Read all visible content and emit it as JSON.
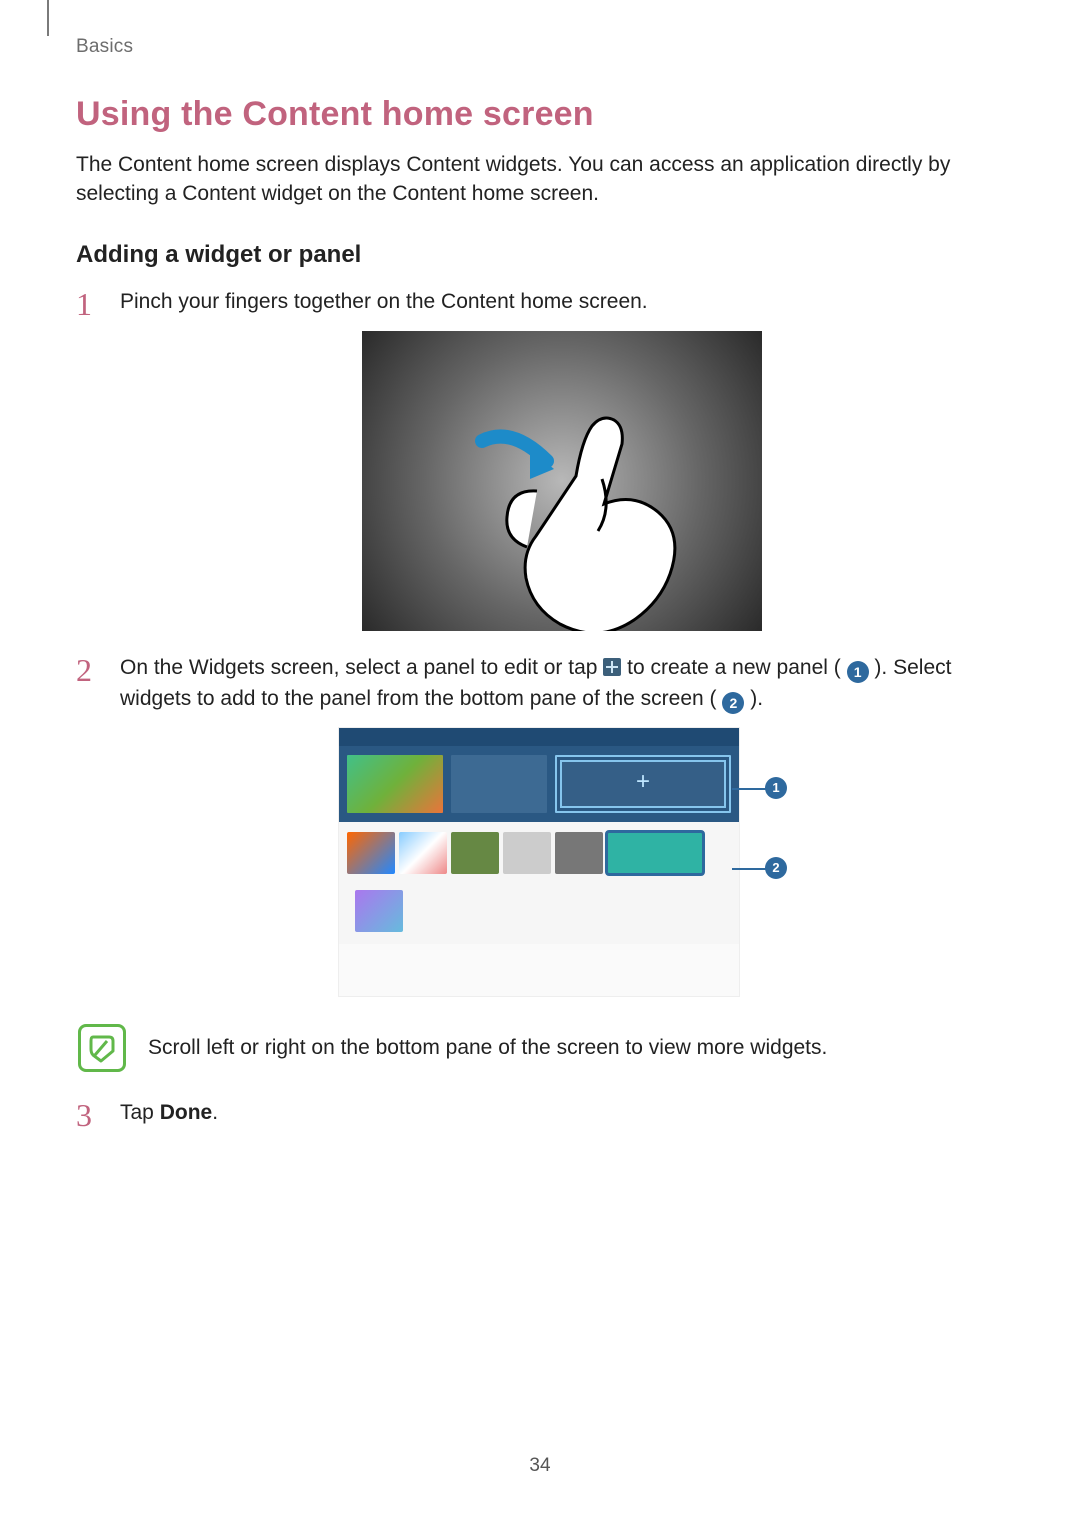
{
  "breadcrumb": "Basics",
  "heading": "Using the Content home screen",
  "intro": "The Content home screen displays Content widgets. You can access an application directly by selecting a Content widget on the Content home screen.",
  "subheading": "Adding a widget or panel",
  "steps": {
    "one": "Pinch your fingers together on the Content home screen.",
    "two_a": "On the Widgets screen, select a panel to edit or tap ",
    "two_b": " to create a new panel ( ",
    "two_c": " ). Select widgets to add to the panel from the bottom pane of the screen ( ",
    "two_d": " ).",
    "three_a": "Tap ",
    "three_b": "Done",
    "three_c": "."
  },
  "callouts": {
    "one": "1",
    "two": "2"
  },
  "note": "Scroll left or right on the bottom pane of the screen to view more widgets.",
  "page_number": "34"
}
